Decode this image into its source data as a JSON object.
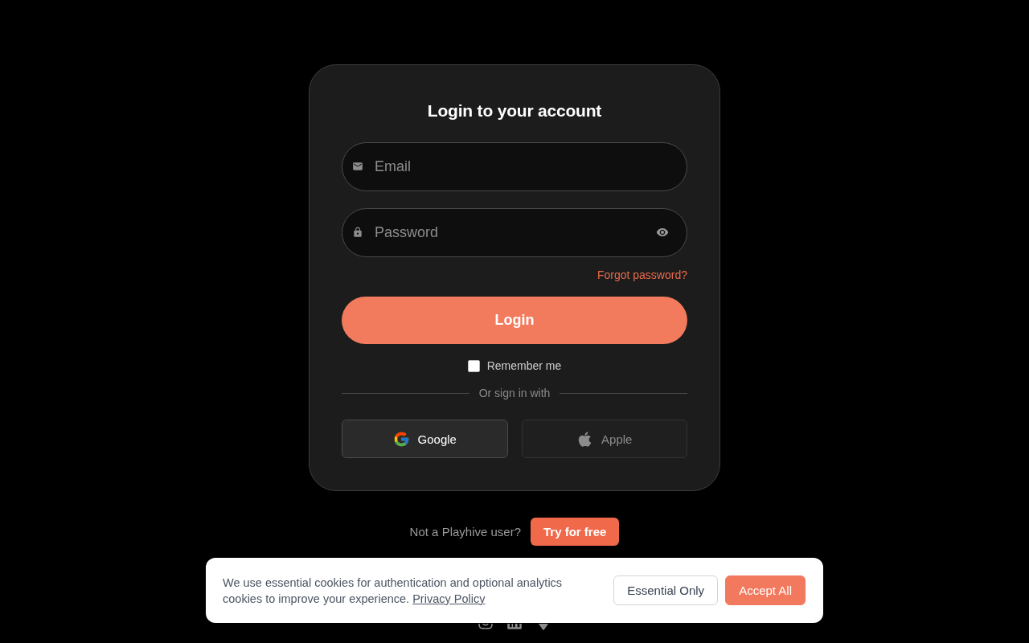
{
  "login_card": {
    "title": "Login to your account",
    "fields": [
      {
        "kind": "email",
        "placeholder": "Email"
      },
      {
        "kind": "password",
        "placeholder": "Password"
      }
    ],
    "forgot_password_link": "Forgot password?",
    "login_button": "Login",
    "remember_me": {
      "label": "Remember me",
      "checked": false
    },
    "divider_label": "Or sign in with",
    "social_buttons": [
      {
        "kind": "google",
        "label": "Google",
        "disabled": false
      },
      {
        "kind": "apple",
        "label": "Apple",
        "disabled": true
      }
    ]
  },
  "signup_prompt": {
    "text": "Not a Playhive user?",
    "button": "Try for free"
  },
  "cookie_banner": {
    "text": "We use essential cookies for authentication and optional analytics cookies to improve your experience.",
    "link": "Privacy Policy",
    "buttons": [
      {
        "kind": "secondary",
        "label": "Essential Only"
      },
      {
        "kind": "primary",
        "label": "Accept All"
      }
    ]
  }
}
